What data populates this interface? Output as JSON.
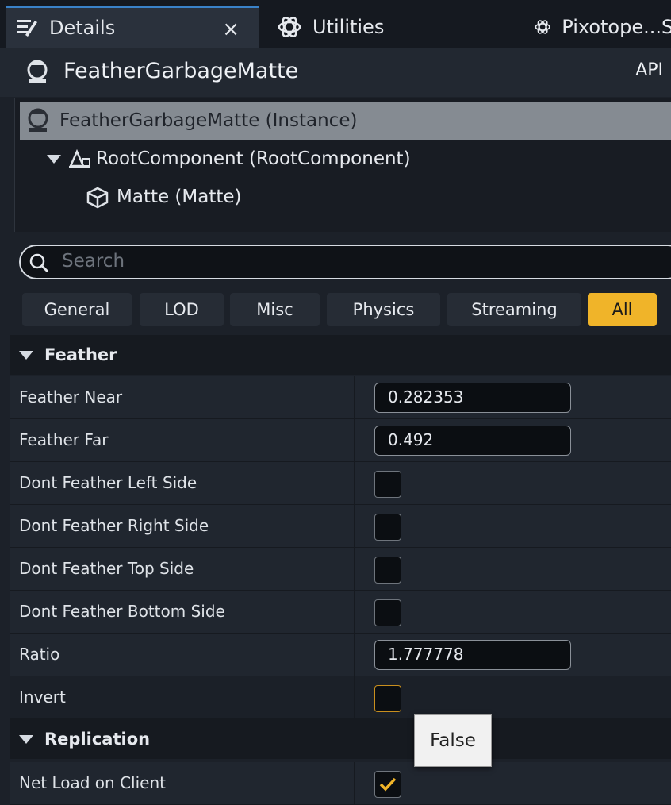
{
  "tabs": {
    "details": {
      "label": "Details",
      "icon": "details-icon"
    },
    "utilities": {
      "label": "Utilities",
      "icon": "atom-icon"
    },
    "pixotope": {
      "label": "Pixotope...Se",
      "icon": "atom-icon"
    },
    "close_glyph": "×"
  },
  "actor": {
    "name": "FeatherGarbageMatte",
    "api_label": "API"
  },
  "tree": {
    "instance": "FeatherGarbageMatte (Instance)",
    "root": "RootComponent (RootComponent)",
    "matte": "Matte (Matte)"
  },
  "search": {
    "placeholder": "Search"
  },
  "filters": [
    "General",
    "LOD",
    "Misc",
    "Physics",
    "Streaming",
    "All"
  ],
  "active_filter": "All",
  "categories": {
    "feather": "Feather",
    "replication": "Replication"
  },
  "properties": {
    "feather_near": {
      "label": "Feather Near",
      "value": "0.282353"
    },
    "feather_far": {
      "label": "Feather Far",
      "value": "0.492"
    },
    "dont_left": {
      "label": "Dont Feather Left Side",
      "checked": false
    },
    "dont_right": {
      "label": "Dont Feather Right Side",
      "checked": false
    },
    "dont_top": {
      "label": "Dont Feather Top Side",
      "checked": false
    },
    "dont_bottom": {
      "label": "Dont Feather Bottom Side",
      "checked": false
    },
    "ratio": {
      "label": "Ratio",
      "value": "1.777778"
    },
    "invert": {
      "label": "Invert",
      "checked": false
    },
    "net_load": {
      "label": "Net Load on Client",
      "checked": true
    }
  },
  "tooltip": "False",
  "colors": {
    "accent": "#f0b429",
    "selection": "#858b92",
    "tab_accent": "#3a82c8"
  }
}
